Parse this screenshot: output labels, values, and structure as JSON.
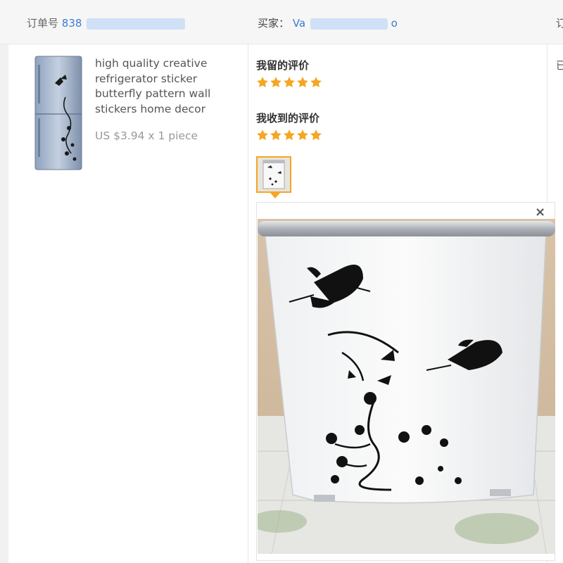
{
  "header": {
    "order_label": "订单号",
    "order_number": "838",
    "buyer_label": "买家：",
    "buyer_name_start": "Va",
    "buyer_name_end": "o",
    "right_cut_text": "订"
  },
  "product": {
    "title": "high quality creative refrigerator sticker butterfly pattern wall stickers home decor",
    "price": "US $3.94 x 1 piece"
  },
  "right_column_cut_text": "已",
  "reviews": {
    "my_review_title": "我留的评价",
    "my_review_rating": 5,
    "received_review_title": "我收到的评价",
    "received_review_rating": 5
  },
  "preview": {
    "close_symbol": "×"
  },
  "colors": {
    "star": "#f5a623",
    "link": "#3b7bd4",
    "thumb_border": "#f5a623"
  },
  "icons": {
    "star": "star-icon",
    "close": "close-icon"
  }
}
